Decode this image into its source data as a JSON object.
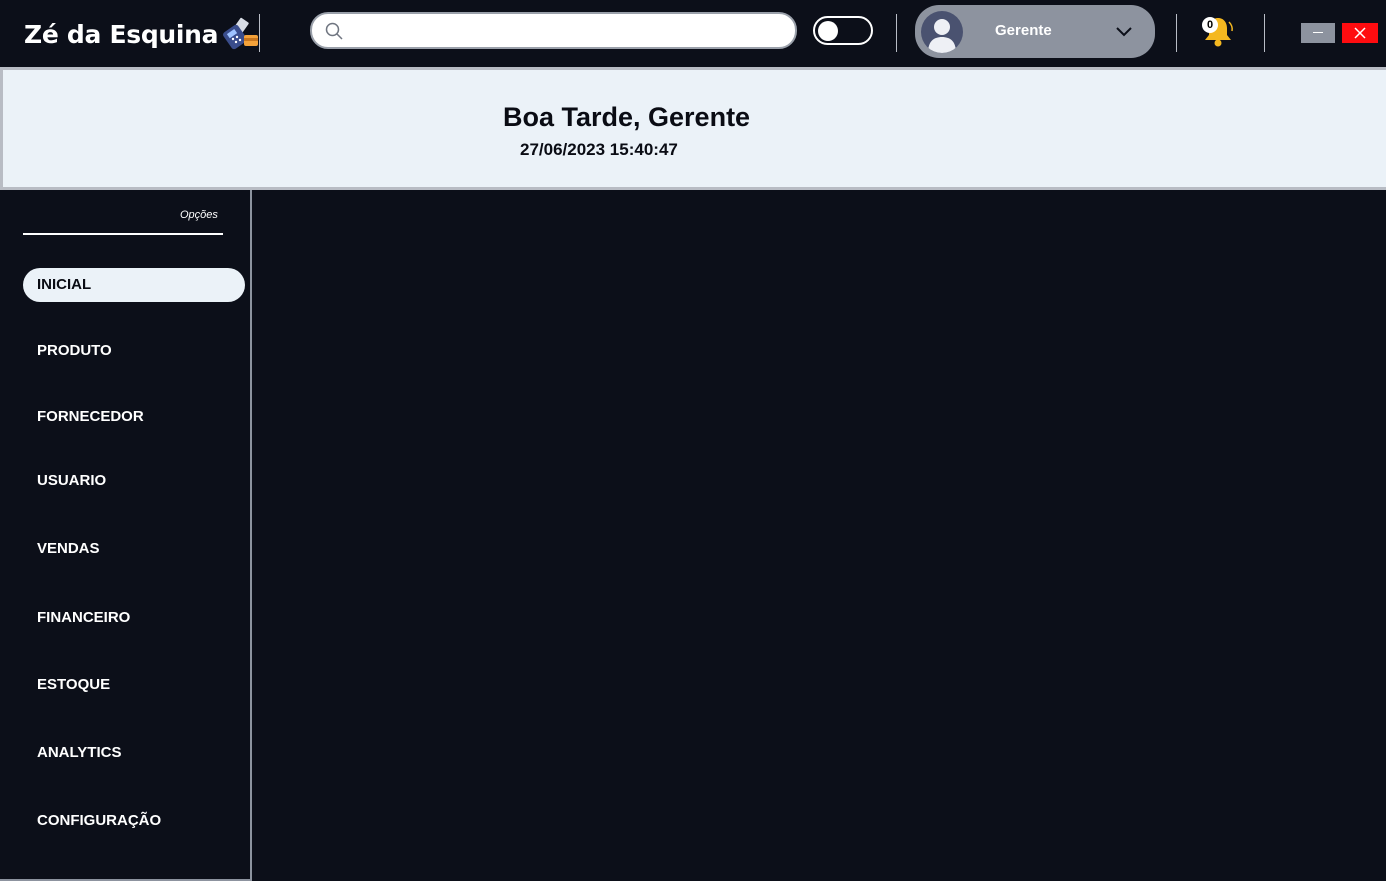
{
  "app": {
    "title": "Zé da Esquina"
  },
  "search": {
    "value": "",
    "placeholder": ""
  },
  "theme_toggle": {
    "state": "off"
  },
  "user": {
    "name": "Gerente"
  },
  "notifications": {
    "count": "0"
  },
  "banner": {
    "greeting": "Boa Tarde, Gerente",
    "datetime": "27/06/2023 15:40:47"
  },
  "sidebar": {
    "options_label": "Opções",
    "items": [
      {
        "label": "INICIAL",
        "active": true
      },
      {
        "label": "PRODUTO",
        "active": false
      },
      {
        "label": "FORNECEDOR",
        "active": false
      },
      {
        "label": "USUARIO",
        "active": false
      },
      {
        "label": "VENDAS",
        "active": false
      },
      {
        "label": "FINANCEIRO",
        "active": false
      },
      {
        "label": "ESTOQUE",
        "active": false
      },
      {
        "label": "ANALYTICS",
        "active": false
      },
      {
        "label": "CONFIGURAÇÃO",
        "active": false
      }
    ]
  },
  "colors": {
    "background": "#0c0f19",
    "banner": "#ebf2f8",
    "pill": "#8d939f",
    "close": "#ff0c10",
    "bell": "#f5b820"
  }
}
